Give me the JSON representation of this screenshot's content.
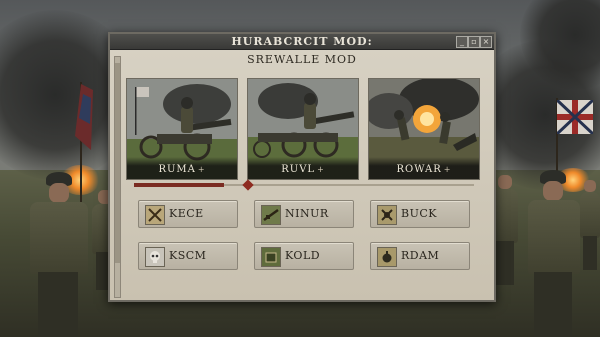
{
  "window": {
    "title": "HURABCRCIT MOD:",
    "subtitle": "SREWALLE MOD",
    "controls": [
      "minimize-icon",
      "restore-icon",
      "close-icon"
    ]
  },
  "cards": [
    {
      "label": "RUMA",
      "marker": "+",
      "icon": "artillery-cannon-art"
    },
    {
      "label": "RUVL",
      "marker": "+",
      "icon": "artillery-cannon-art"
    },
    {
      "label": "ROWAR",
      "marker": "+",
      "icon": "battle-explosion-art"
    }
  ],
  "options": [
    {
      "label": "KECE",
      "icon": "crossed-swords-icon"
    },
    {
      "label": "NINUR",
      "icon": "rifle-icon"
    },
    {
      "label": "BUCK",
      "icon": "crossed-arms-icon"
    },
    {
      "label": "KSCM",
      "icon": "skull-icon"
    },
    {
      "label": "KOLD",
      "icon": "ammo-crate-icon"
    },
    {
      "label": "RDAM",
      "icon": "grenade-icon"
    }
  ],
  "colors": {
    "accent": "#7b2c22",
    "panel": "#d3ccbd",
    "titlebar": "#444441"
  }
}
